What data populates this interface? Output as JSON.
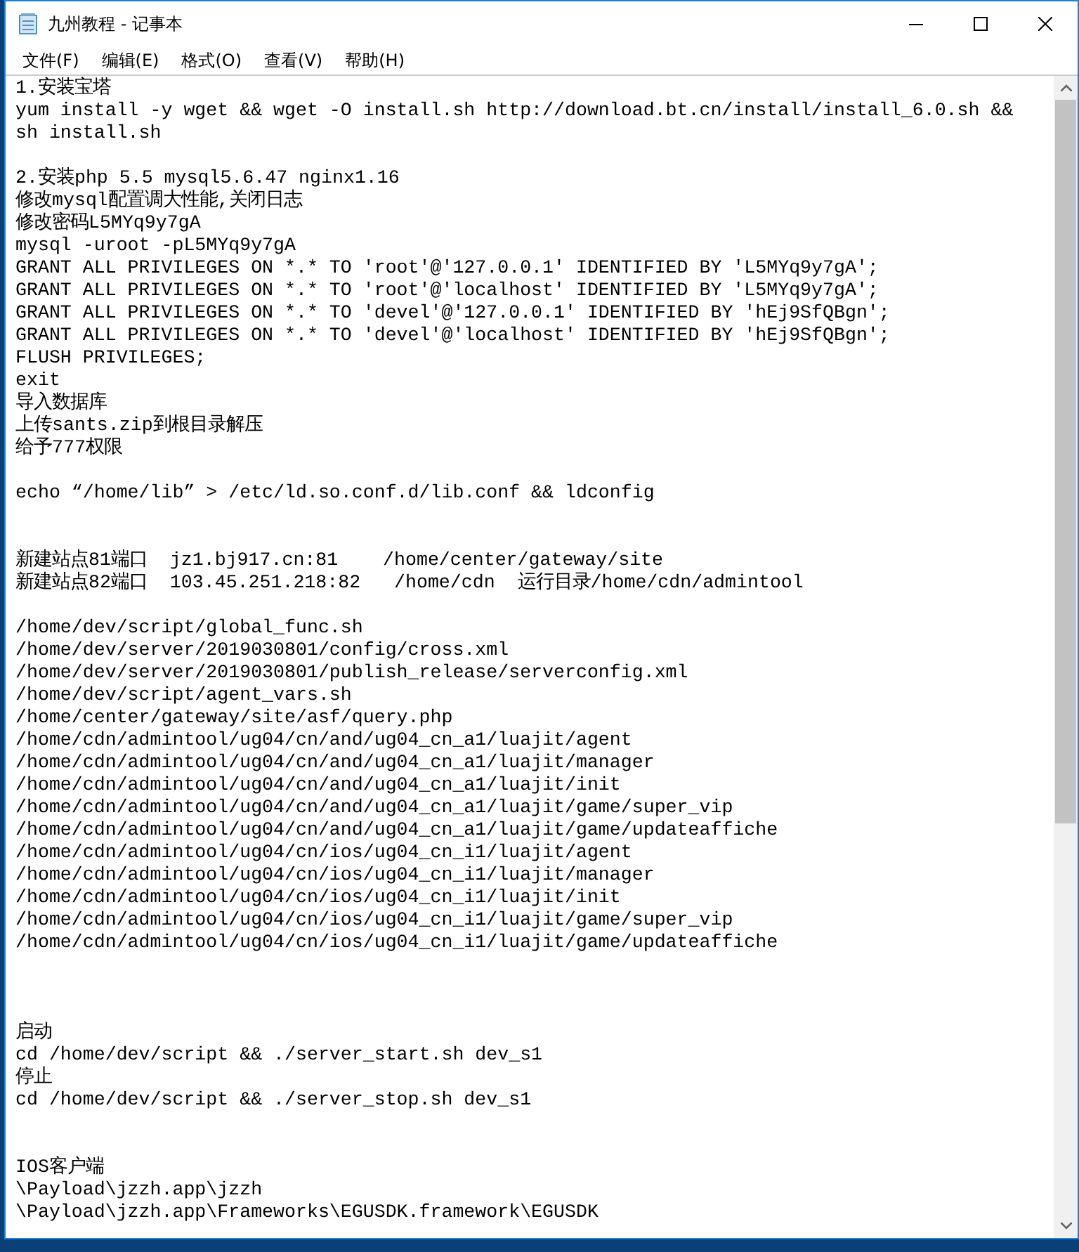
{
  "window": {
    "title": "九州教程 - 记事本"
  },
  "menu": [
    {
      "label": "文件(F)"
    },
    {
      "label": "编辑(E)"
    },
    {
      "label": "格式(O)"
    },
    {
      "label": "查看(V)"
    },
    {
      "label": "帮助(H)"
    }
  ],
  "lines": [
    {
      "kind": "text",
      "text": "1.安装宝塔"
    },
    {
      "kind": "text",
      "text": "yum install -y wget && wget -O install.sh http://download.bt.cn/install/install_6.0.sh &&"
    },
    {
      "kind": "text",
      "text": "sh install.sh"
    },
    {
      "kind": "blank"
    },
    {
      "kind": "text",
      "text": "2.安装php 5.5 mysql5.6.47 nginx1.16"
    },
    {
      "kind": "text",
      "text": "修改mysql配置调大性能,关闭日志"
    },
    {
      "kind": "text",
      "text": "修改密码L5MYq9y7gA"
    },
    {
      "kind": "text",
      "text": "mysql -uroot -pL5MYq9y7gA"
    },
    {
      "kind": "text",
      "text": "GRANT ALL PRIVILEGES ON *.* TO 'root'@'127.0.0.1' IDENTIFIED BY 'L5MYq9y7gA';"
    },
    {
      "kind": "text",
      "text": "GRANT ALL PRIVILEGES ON *.* TO 'root'@'localhost' IDENTIFIED BY 'L5MYq9y7gA';"
    },
    {
      "kind": "text",
      "text": "GRANT ALL PRIVILEGES ON *.* TO 'devel'@'127.0.0.1' IDENTIFIED BY 'hEj9SfQBgn';"
    },
    {
      "kind": "text",
      "text": "GRANT ALL PRIVILEGES ON *.* TO 'devel'@'localhost' IDENTIFIED BY 'hEj9SfQBgn';"
    },
    {
      "kind": "text",
      "text": "FLUSH PRIVILEGES;"
    },
    {
      "kind": "text",
      "text": "exit"
    },
    {
      "kind": "text",
      "text": "导入数据库"
    },
    {
      "kind": "text",
      "text": "上传sants.zip到根目录解压"
    },
    {
      "kind": "text",
      "text": "给予777权限"
    },
    {
      "kind": "blank"
    },
    {
      "kind": "text",
      "text": "echo “/home/lib” > /etc/ld.so.conf.d/lib.conf && ldconfig"
    },
    {
      "kind": "blank"
    },
    {
      "kind": "blank"
    },
    {
      "kind": "text",
      "text": "新建站点81端口  jz1.bj917.cn:81    /home/center/gateway/site"
    },
    {
      "kind": "text",
      "text": "新建站点82端口  103.45.251.218:82   /home/cdn  运行目录/home/cdn/admintool"
    },
    {
      "kind": "blank"
    },
    {
      "kind": "text",
      "text": "/home/dev/script/global_func.sh"
    },
    {
      "kind": "text",
      "text": "/home/dev/server/2019030801/config/cross.xml"
    },
    {
      "kind": "text",
      "text": "/home/dev/server/2019030801/publish_release/serverconfig.xml"
    },
    {
      "kind": "text",
      "text": "/home/dev/script/agent_vars.sh"
    },
    {
      "kind": "text",
      "text": "/home/center/gateway/site/asf/query.php"
    },
    {
      "kind": "text",
      "text": "/home/cdn/admintool/ug04/cn/and/ug04_cn_a1/luajit/agent"
    },
    {
      "kind": "text",
      "text": "/home/cdn/admintool/ug04/cn/and/ug04_cn_a1/luajit/manager"
    },
    {
      "kind": "text",
      "text": "/home/cdn/admintool/ug04/cn/and/ug04_cn_a1/luajit/init"
    },
    {
      "kind": "text",
      "text": "/home/cdn/admintool/ug04/cn/and/ug04_cn_a1/luajit/game/super_vip"
    },
    {
      "kind": "text",
      "text": "/home/cdn/admintool/ug04/cn/and/ug04_cn_a1/luajit/game/updateaffiche"
    },
    {
      "kind": "text",
      "text": "/home/cdn/admintool/ug04/cn/ios/ug04_cn_i1/luajit/agent"
    },
    {
      "kind": "text",
      "text": "/home/cdn/admintool/ug04/cn/ios/ug04_cn_i1/luajit/manager"
    },
    {
      "kind": "text",
      "text": "/home/cdn/admintool/ug04/cn/ios/ug04_cn_i1/luajit/init"
    },
    {
      "kind": "text",
      "text": "/home/cdn/admintool/ug04/cn/ios/ug04_cn_i1/luajit/game/super_vip"
    },
    {
      "kind": "text",
      "text": "/home/cdn/admintool/ug04/cn/ios/ug04_cn_i1/luajit/game/updateaffiche"
    },
    {
      "kind": "blank"
    },
    {
      "kind": "blank"
    },
    {
      "kind": "blank"
    },
    {
      "kind": "text",
      "text": "启动"
    },
    {
      "kind": "text",
      "text": "cd /home/dev/script && ./server_start.sh dev_s1"
    },
    {
      "kind": "text",
      "text": "停止"
    },
    {
      "kind": "text",
      "text": "cd /home/dev/script && ./server_stop.sh dev_s1"
    },
    {
      "kind": "blank"
    },
    {
      "kind": "blank"
    },
    {
      "kind": "text",
      "text": "IOS客户端"
    },
    {
      "kind": "text",
      "text": "\\Payload\\jzzh.app\\jzzh"
    },
    {
      "kind": "text",
      "text": "\\Payload\\jzzh.app\\Frameworks\\EGUSDK.framework\\EGUSDK"
    }
  ]
}
